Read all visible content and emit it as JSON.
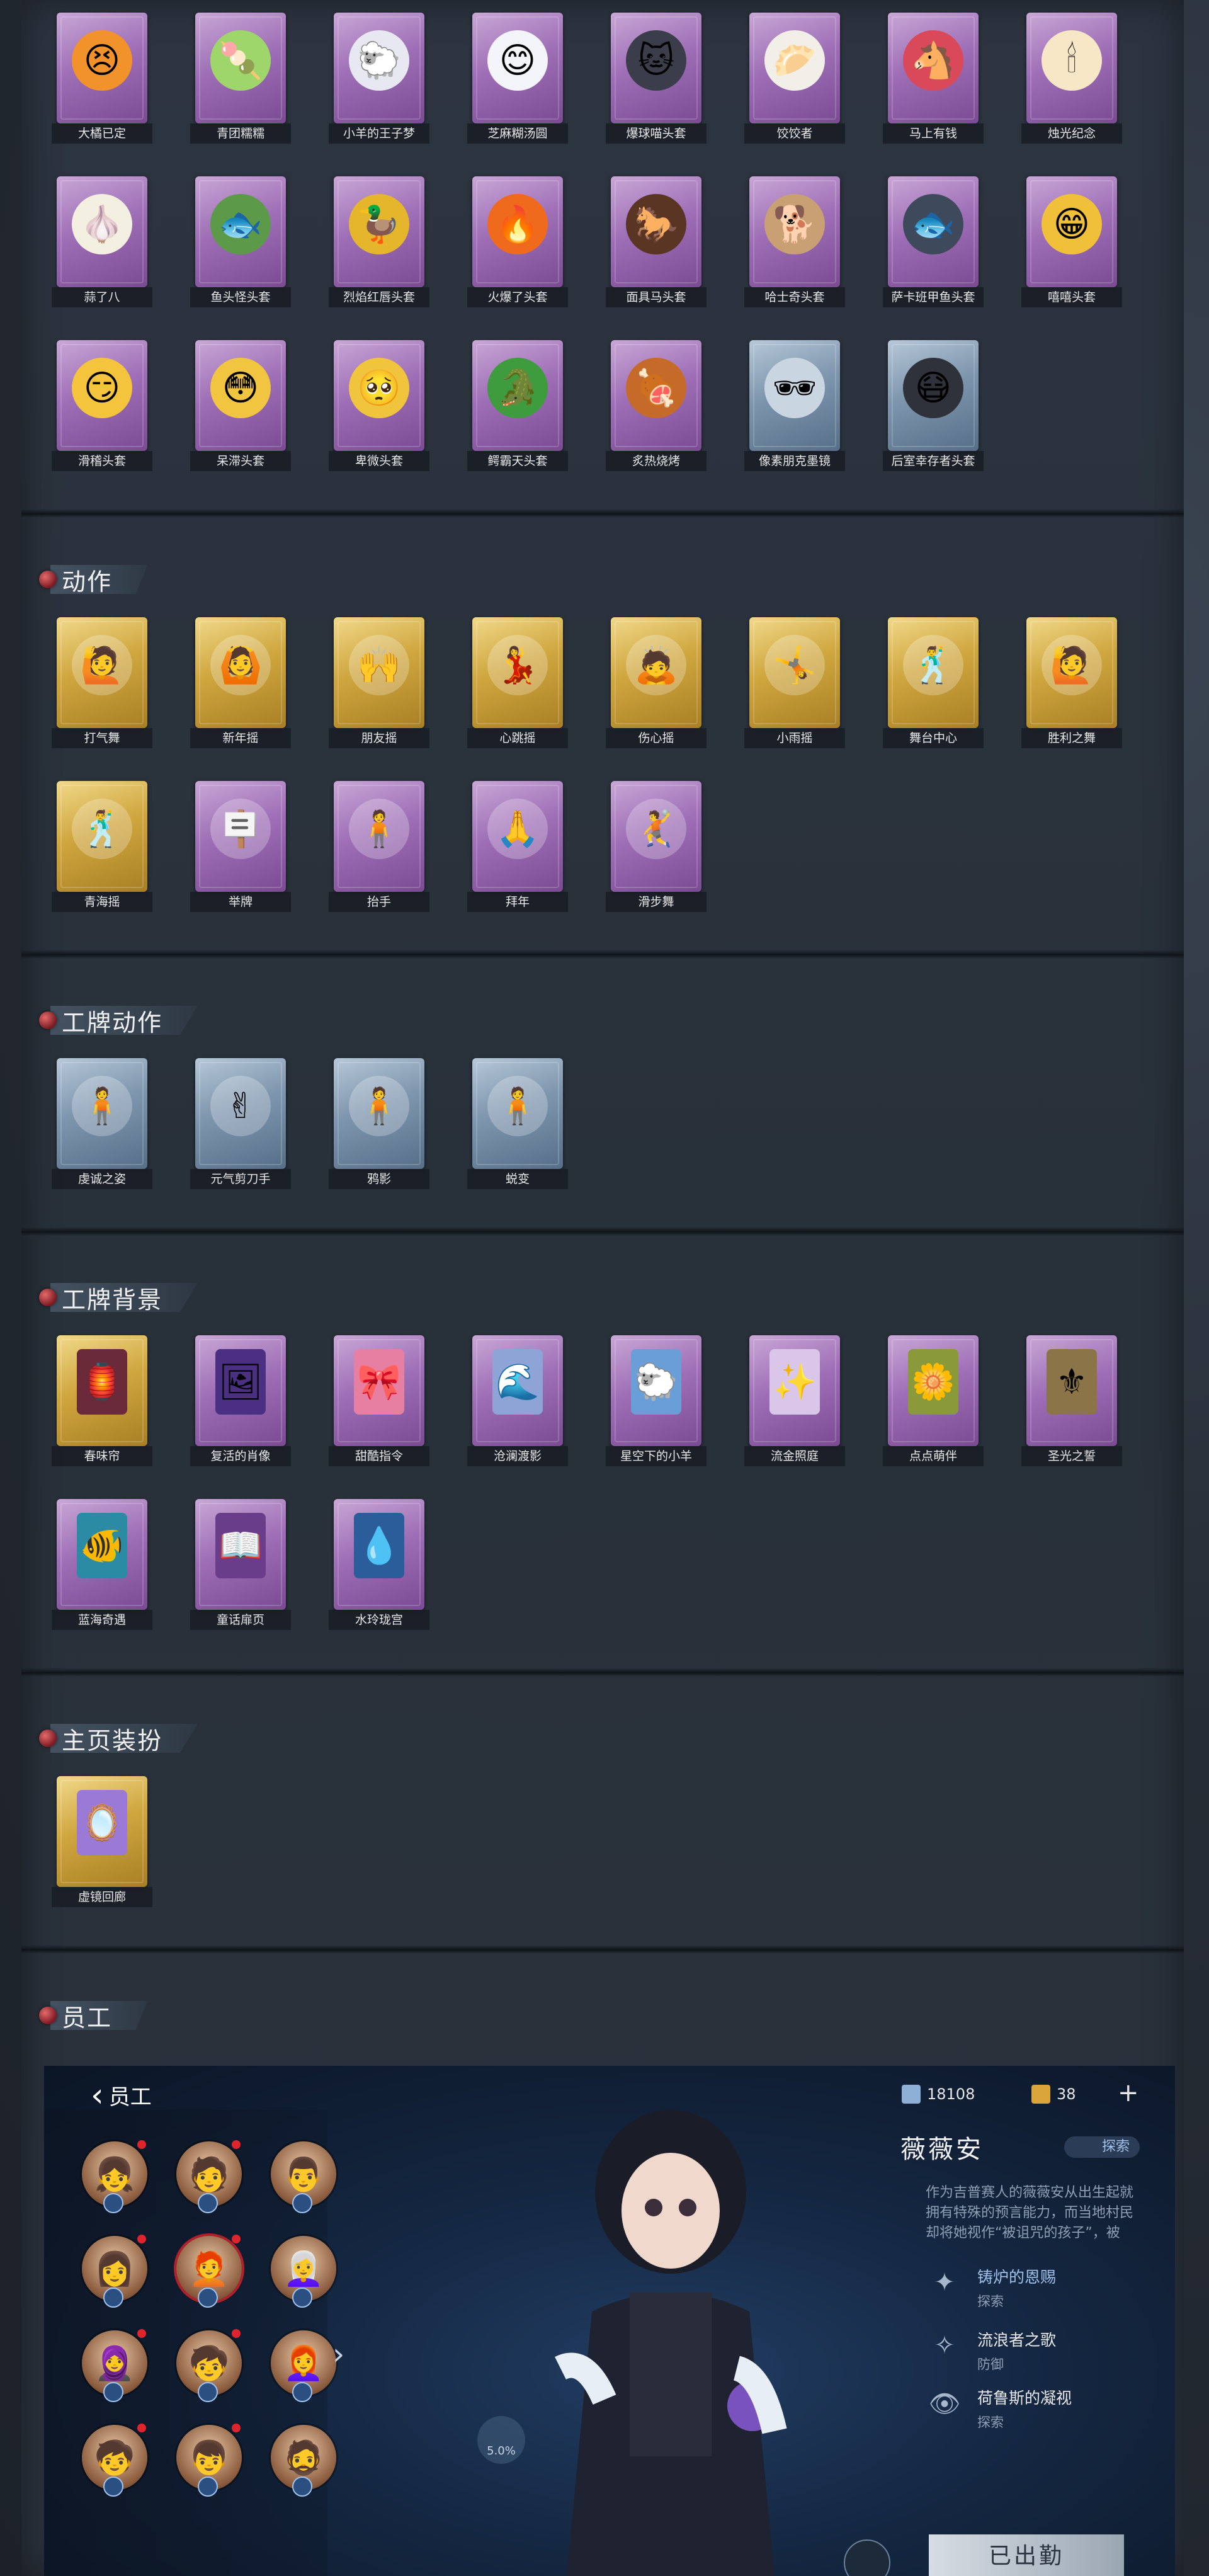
{
  "sections": {
    "heads": {
      "items": [
        {
          "label": "大橘已定",
          "color": "purple",
          "glyph": "😣",
          "bg": "#f2922b"
        },
        {
          "label": "青团糯糯",
          "color": "purple",
          "glyph": "🍡",
          "bg": "#9fd66c"
        },
        {
          "label": "小羊的王子梦",
          "color": "purple",
          "glyph": "🐑",
          "bg": "#e8e8f2"
        },
        {
          "label": "芝麻糊汤圆",
          "color": "purple",
          "glyph": "😊",
          "bg": "#f4f4fb"
        },
        {
          "label": "爆球喵头套",
          "color": "purple",
          "glyph": "🐱",
          "bg": "#3c3d4a"
        },
        {
          "label": "饺饺者",
          "color": "purple",
          "glyph": "🥟",
          "bg": "#f1efe8"
        },
        {
          "label": "马上有钱",
          "color": "purple",
          "glyph": "🐴",
          "bg": "#d9495a"
        },
        {
          "label": "烛光纪念",
          "color": "purple",
          "glyph": "🕯",
          "bg": "#f7e7c7"
        },
        {
          "label": "蒜了八",
          "color": "purple",
          "glyph": "🧄",
          "bg": "#f3f0e1"
        },
        {
          "label": "鱼头怪头套",
          "color": "purple",
          "glyph": "🐟",
          "bg": "#5c9a4a"
        },
        {
          "label": "烈焰红唇头套",
          "color": "purple",
          "glyph": "🦆",
          "bg": "#e5b62b"
        },
        {
          "label": "火爆了头套",
          "color": "purple",
          "glyph": "🔥",
          "bg": "#ef6a1d"
        },
        {
          "label": "面具马头套",
          "color": "purple",
          "glyph": "🐎",
          "bg": "#5a3524"
        },
        {
          "label": "哈士奇头套",
          "color": "purple",
          "glyph": "🐕",
          "bg": "#c9a074"
        },
        {
          "label": "萨卡班甲鱼头套",
          "color": "purple",
          "glyph": "🐟",
          "bg": "#3e4a5c"
        },
        {
          "label": "嘻嘻头套",
          "color": "purple",
          "glyph": "😁",
          "bg": "#f0c03a"
        },
        {
          "label": "滑稽头套",
          "color": "purple",
          "glyph": "😏",
          "bg": "#f3c43c"
        },
        {
          "label": "呆滞头套",
          "color": "purple",
          "glyph": "😳",
          "bg": "#f1c53f"
        },
        {
          "label": "卑微头套",
          "color": "purple",
          "glyph": "🥺",
          "bg": "#f0c43c"
        },
        {
          "label": "鳄霸天头套",
          "color": "purple",
          "glyph": "🐊",
          "bg": "#3e9b3e"
        },
        {
          "label": "炙热烧烤",
          "color": "purple",
          "glyph": "🍖",
          "bg": "#c66a2a"
        },
        {
          "label": "像素朋克墨镜",
          "color": "blue",
          "glyph": "🕶",
          "bg": "#c9d6e2"
        },
        {
          "label": "后室幸存者头套",
          "color": "blue",
          "glyph": "😷",
          "bg": "#2f323a"
        }
      ]
    },
    "actions": {
      "title": "动作",
      "items": [
        {
          "label": "打气舞",
          "color": "gold",
          "glyph": "🙋"
        },
        {
          "label": "新年摇",
          "color": "gold",
          "glyph": "🙆"
        },
        {
          "label": "朋友摇",
          "color": "gold",
          "glyph": "🙌"
        },
        {
          "label": "心跳摇",
          "color": "gold",
          "glyph": "💃"
        },
        {
          "label": "伤心摇",
          "color": "gold",
          "glyph": "🙇"
        },
        {
          "label": "小雨摇",
          "color": "gold",
          "glyph": "🤸"
        },
        {
          "label": "舞台中心",
          "color": "gold",
          "glyph": "🕺"
        },
        {
          "label": "胜利之舞",
          "color": "gold",
          "glyph": "🙋"
        },
        {
          "label": "青海摇",
          "color": "gold",
          "glyph": "🕺"
        },
        {
          "label": "举牌",
          "color": "purple",
          "glyph": "🪧"
        },
        {
          "label": "抬手",
          "color": "purple",
          "glyph": "🧍"
        },
        {
          "label": "拜年",
          "color": "purple",
          "glyph": "🙏"
        },
        {
          "label": "滑步舞",
          "color": "purple",
          "glyph": "🤾"
        }
      ]
    },
    "badge_actions": {
      "title": "工牌动作",
      "items": [
        {
          "label": "虔诚之姿",
          "color": "blue",
          "glyph": "🧍"
        },
        {
          "label": "元气剪刀手",
          "color": "blue",
          "glyph": "✌"
        },
        {
          "label": "鸦影",
          "color": "blue",
          "glyph": "🧍"
        },
        {
          "label": "蜕变",
          "color": "blue",
          "glyph": "🧍"
        }
      ]
    },
    "badge_bgs": {
      "title": "工牌背景",
      "items": [
        {
          "label": "春味帘",
          "color": "gold",
          "glyph": "🏮",
          "bg": "#6a2a3a"
        },
        {
          "label": "复活的肖像",
          "color": "purple",
          "glyph": "🖼",
          "bg": "#4a2f82"
        },
        {
          "label": "甜酷指令",
          "color": "purple",
          "glyph": "🎀",
          "bg": "#e77fa3"
        },
        {
          "label": "沧澜渡影",
          "color": "purple",
          "glyph": "🌊",
          "bg": "#8ea3d6"
        },
        {
          "label": "星空下的小羊",
          "color": "purple",
          "glyph": "🐑",
          "bg": "#6a9ed6"
        },
        {
          "label": "流金照庭",
          "color": "purple",
          "glyph": "✨",
          "bg": "#d9c6e9"
        },
        {
          "label": "点点萌伴",
          "color": "purple",
          "glyph": "🌼",
          "bg": "#8a9a3a"
        },
        {
          "label": "圣光之誓",
          "color": "purple",
          "glyph": "⚜",
          "bg": "#8a7448"
        },
        {
          "label": "蓝海奇遇",
          "color": "purple",
          "glyph": "🐠",
          "bg": "#2b8aa4"
        },
        {
          "label": "童话扉页",
          "color": "purple",
          "glyph": "📖",
          "bg": "#6a3d8a"
        },
        {
          "label": "水玲珑宫",
          "color": "purple",
          "glyph": "💧",
          "bg": "#2a5d9a"
        }
      ]
    },
    "home_decor": {
      "title": "主页装扮",
      "items": [
        {
          "label": "虚镜回廊",
          "color": "gold",
          "glyph": "🪞",
          "bg": "#9a7ad6"
        }
      ]
    },
    "staff": {
      "title": "员工"
    }
  },
  "staff_screen": {
    "back_label": "员工",
    "currency1": "18108",
    "currency2": "38",
    "plus": "+",
    "char_name": "薇薇安",
    "char_role": "探索",
    "char_desc": "作为吉普赛人的薇薇安从出生起就拥有特殊的预言能力，而当地村民却将她视作“被诅咒的孩子”，被送进那座有着奇异魔法的要塞……",
    "skills": [
      {
        "name": "铸炉的恩赐",
        "type": "探索",
        "icon": "✦",
        "highlight": true
      },
      {
        "name": "流浪者之歌",
        "type": "防御",
        "icon": "✧",
        "highlight": false
      },
      {
        "name": "荷鲁斯的凝视",
        "type": "探索",
        "icon": "👁",
        "highlight": false
      }
    ],
    "rate_label": "5.0%",
    "deploy_label": "已出勤",
    "roster_glyphs": [
      "👧",
      "🧑",
      "👨",
      "👩",
      "🧑‍🦰",
      "👩‍🦳",
      "🧕",
      "🧒",
      "👩‍🦰",
      "🧒",
      "👦",
      "🧔"
    ]
  }
}
